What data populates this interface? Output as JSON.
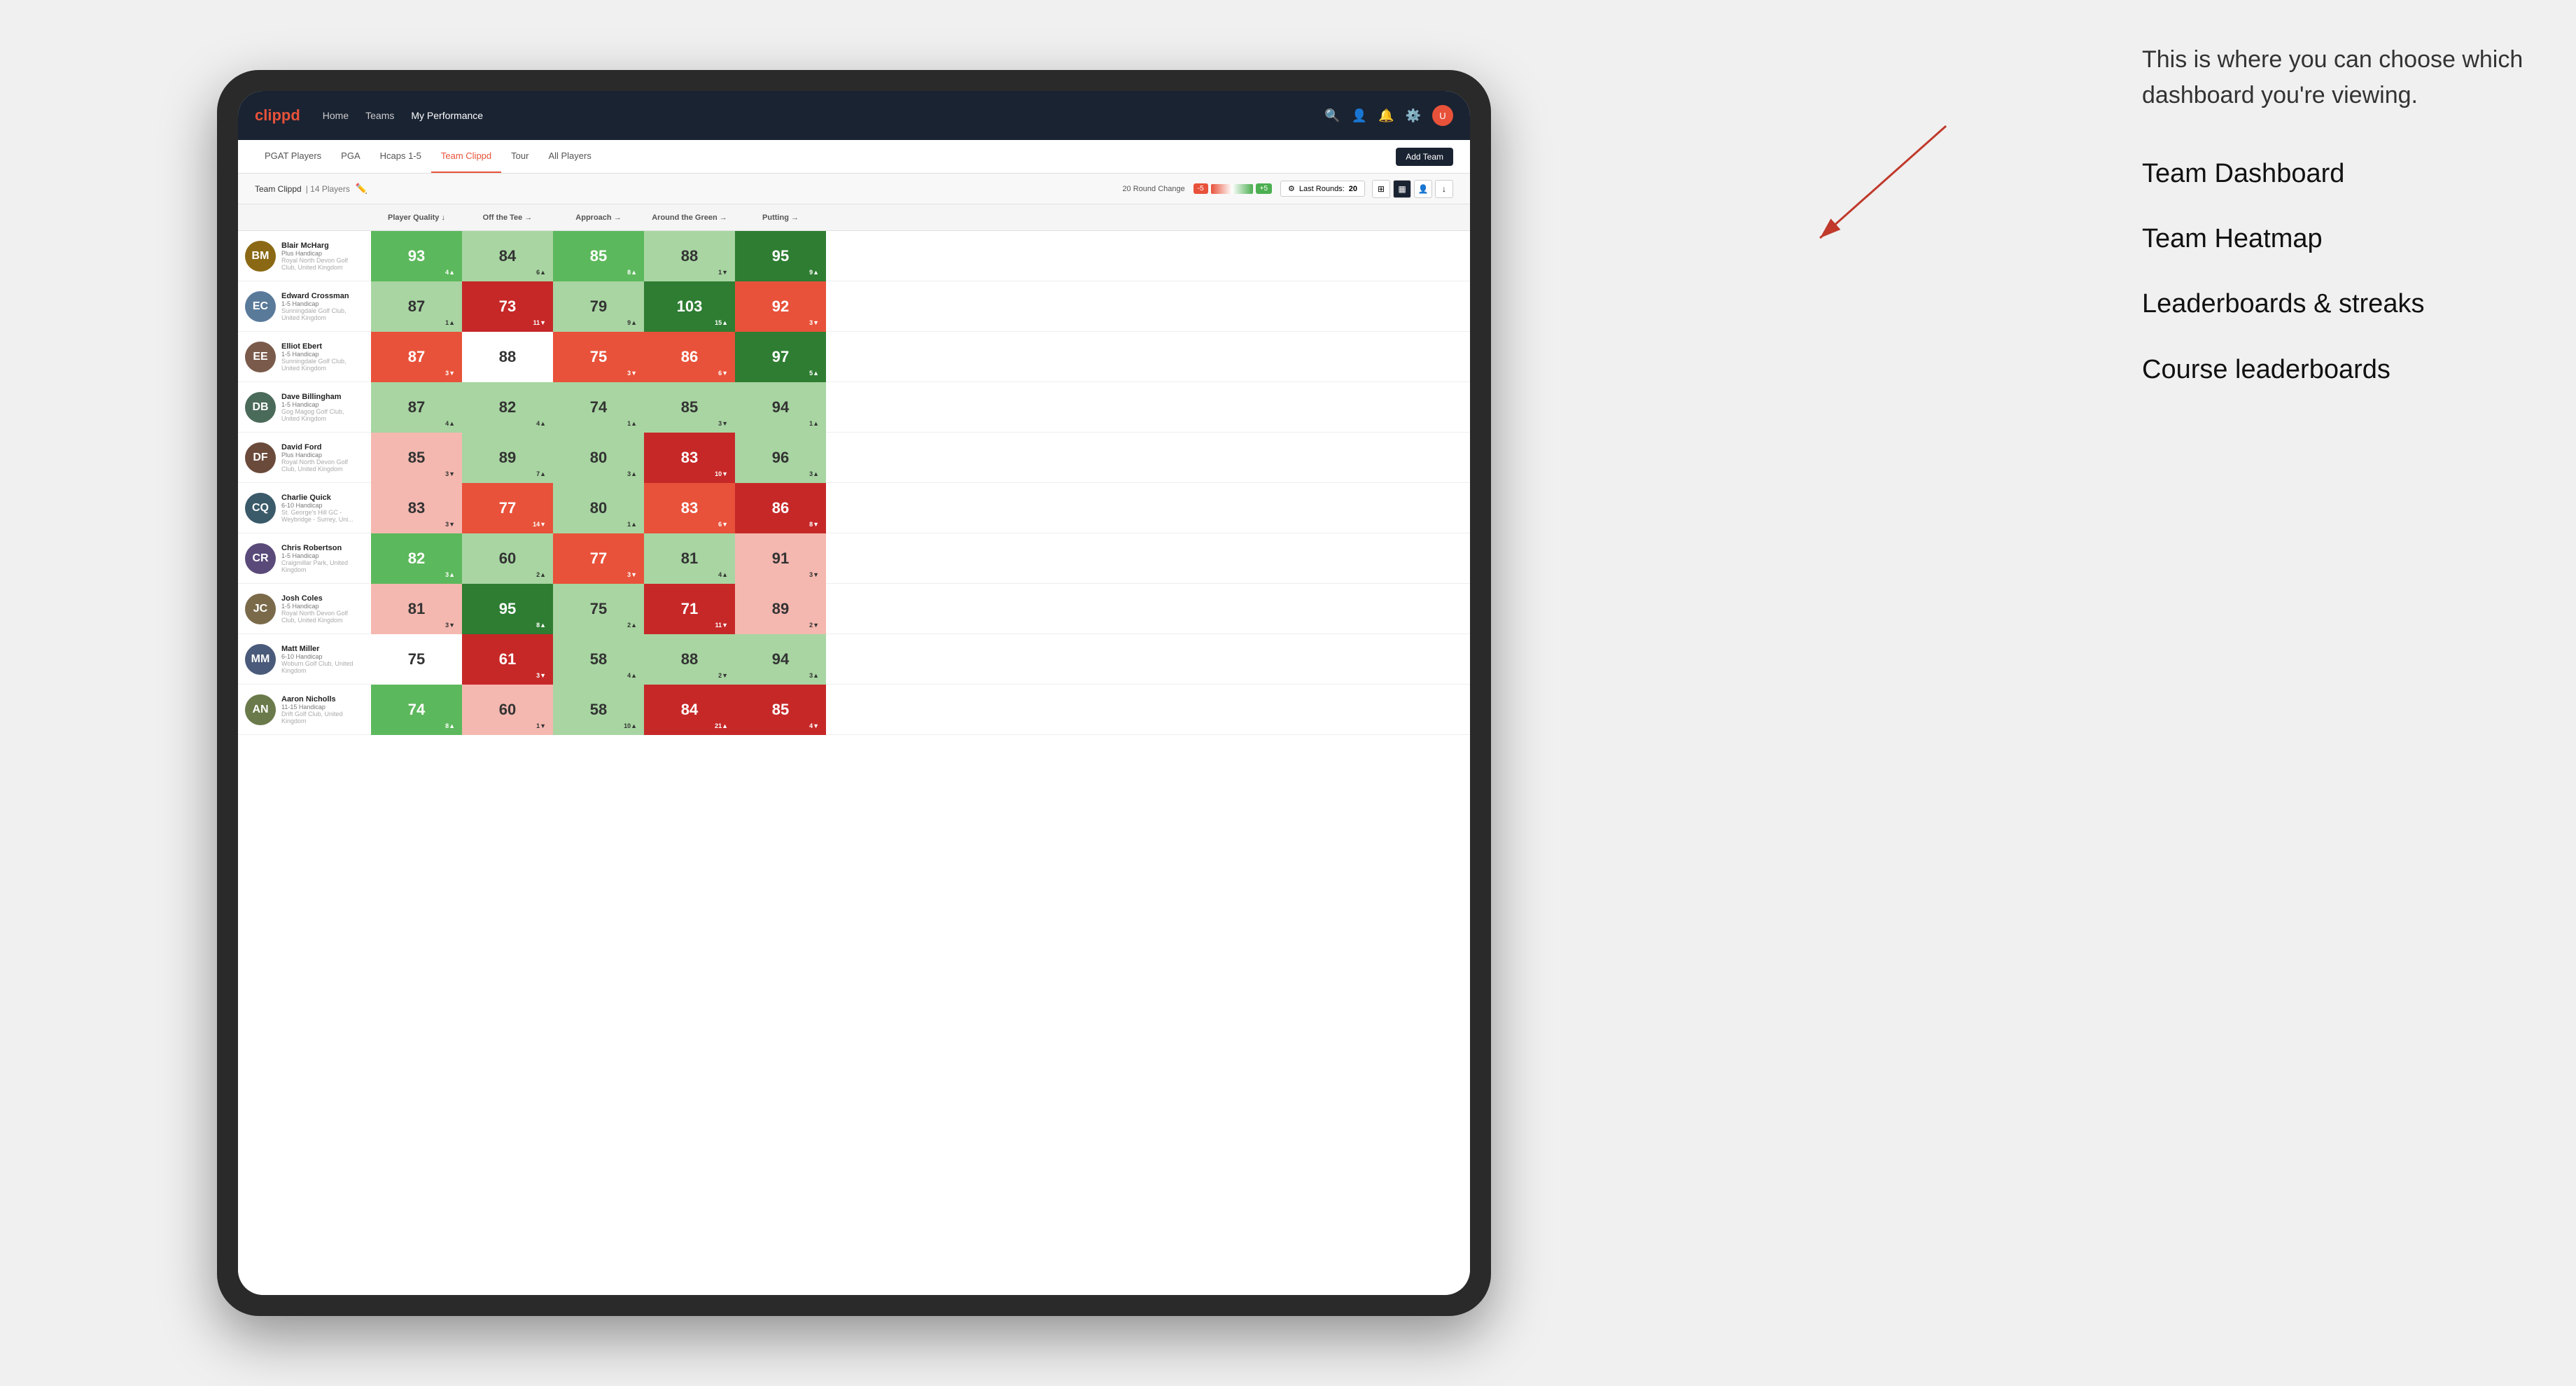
{
  "annotation": {
    "intro": "This is where you can choose which dashboard you're viewing.",
    "items": [
      "Team Dashboard",
      "Team Heatmap",
      "Leaderboards & streaks",
      "Course leaderboards"
    ]
  },
  "nav": {
    "logo": "clippd",
    "items": [
      "Home",
      "Teams",
      "My Performance"
    ],
    "icons": [
      "search",
      "user",
      "bell",
      "settings",
      "avatar"
    ]
  },
  "tabs": {
    "items": [
      "PGAT Players",
      "PGA",
      "Hcaps 1-5",
      "Team Clippd",
      "Tour",
      "All Players"
    ],
    "active": "Team Clippd",
    "add_button": "Add Team"
  },
  "sub_header": {
    "team_name": "Team Clippd",
    "player_count": "| 14 Players",
    "round_change_label": "20 Round Change",
    "badge_neg": "-5",
    "badge_pos": "+5",
    "last_rounds_label": "Last Rounds:",
    "last_rounds_value": "20"
  },
  "table": {
    "headers": [
      "Player Quality ↓",
      "Off the Tee →",
      "Approach →",
      "Around the Green →",
      "Putting →"
    ],
    "players": [
      {
        "name": "Blair McHarg",
        "handicap": "Plus Handicap",
        "club": "Royal North Devon Golf Club, United Kingdom",
        "initials": "BM",
        "color": "#8B6914",
        "scores": [
          {
            "value": "93",
            "change": "4",
            "dir": "up",
            "style": "mid-green"
          },
          {
            "value": "84",
            "change": "6",
            "dir": "up",
            "style": "light-green"
          },
          {
            "value": "85",
            "change": "8",
            "dir": "up",
            "style": "mid-green"
          },
          {
            "value": "88",
            "change": "1",
            "dir": "down",
            "style": "light-green"
          },
          {
            "value": "95",
            "change": "9",
            "dir": "up",
            "style": "dark-green"
          }
        ]
      },
      {
        "name": "Edward Crossman",
        "handicap": "1-5 Handicap",
        "club": "Sunningdale Golf Club, United Kingdom",
        "initials": "EC",
        "color": "#5a7a9a",
        "scores": [
          {
            "value": "87",
            "change": "1",
            "dir": "up",
            "style": "light-green"
          },
          {
            "value": "73",
            "change": "11",
            "dir": "down",
            "style": "dark-red"
          },
          {
            "value": "79",
            "change": "9",
            "dir": "up",
            "style": "light-green"
          },
          {
            "value": "103",
            "change": "15",
            "dir": "up",
            "style": "dark-green"
          },
          {
            "value": "92",
            "change": "3",
            "dir": "down",
            "style": "mid-red"
          }
        ]
      },
      {
        "name": "Elliot Ebert",
        "handicap": "1-5 Handicap",
        "club": "Sunningdale Golf Club, United Kingdom",
        "initials": "EE",
        "color": "#7a5a4a",
        "scores": [
          {
            "value": "87",
            "change": "3",
            "dir": "down",
            "style": "mid-red"
          },
          {
            "value": "88",
            "change": "",
            "dir": "",
            "style": "white"
          },
          {
            "value": "75",
            "change": "3",
            "dir": "down",
            "style": "mid-red"
          },
          {
            "value": "86",
            "change": "6",
            "dir": "down",
            "style": "mid-red"
          },
          {
            "value": "97",
            "change": "5",
            "dir": "up",
            "style": "dark-green"
          }
        ]
      },
      {
        "name": "Dave Billingham",
        "handicap": "1-5 Handicap",
        "club": "Gog Magog Golf Club, United Kingdom",
        "initials": "DB",
        "color": "#4a6a5a",
        "scores": [
          {
            "value": "87",
            "change": "4",
            "dir": "up",
            "style": "light-green"
          },
          {
            "value": "82",
            "change": "4",
            "dir": "up",
            "style": "light-green"
          },
          {
            "value": "74",
            "change": "1",
            "dir": "up",
            "style": "light-green"
          },
          {
            "value": "85",
            "change": "3",
            "dir": "down",
            "style": "light-green"
          },
          {
            "value": "94",
            "change": "1",
            "dir": "up",
            "style": "light-green"
          }
        ]
      },
      {
        "name": "David Ford",
        "handicap": "Plus Handicap",
        "club": "Royal North Devon Golf Club, United Kingdom",
        "initials": "DF",
        "color": "#6a4a3a",
        "scores": [
          {
            "value": "85",
            "change": "3",
            "dir": "down",
            "style": "light-red"
          },
          {
            "value": "89",
            "change": "7",
            "dir": "up",
            "style": "light-green"
          },
          {
            "value": "80",
            "change": "3",
            "dir": "up",
            "style": "light-green"
          },
          {
            "value": "83",
            "change": "10",
            "dir": "down",
            "style": "dark-red"
          },
          {
            "value": "96",
            "change": "3",
            "dir": "up",
            "style": "light-green"
          }
        ]
      },
      {
        "name": "Charlie Quick",
        "handicap": "6-10 Handicap",
        "club": "St. George's Hill GC - Weybridge - Surrey, Uni...",
        "initials": "CQ",
        "color": "#3a5a6a",
        "scores": [
          {
            "value": "83",
            "change": "3",
            "dir": "down",
            "style": "light-red"
          },
          {
            "value": "77",
            "change": "14",
            "dir": "down",
            "style": "mid-red"
          },
          {
            "value": "80",
            "change": "1",
            "dir": "up",
            "style": "light-green"
          },
          {
            "value": "83",
            "change": "6",
            "dir": "down",
            "style": "mid-red"
          },
          {
            "value": "86",
            "change": "8",
            "dir": "down",
            "style": "dark-red"
          }
        ]
      },
      {
        "name": "Chris Robertson",
        "handicap": "1-5 Handicap",
        "club": "Craigmillar Park, United Kingdom",
        "initials": "CR",
        "color": "#5a4a7a",
        "scores": [
          {
            "value": "82",
            "change": "3",
            "dir": "up",
            "style": "mid-green"
          },
          {
            "value": "60",
            "change": "2",
            "dir": "up",
            "style": "light-green"
          },
          {
            "value": "77",
            "change": "3",
            "dir": "down",
            "style": "mid-red"
          },
          {
            "value": "81",
            "change": "4",
            "dir": "up",
            "style": "light-green"
          },
          {
            "value": "91",
            "change": "3",
            "dir": "down",
            "style": "light-red"
          }
        ]
      },
      {
        "name": "Josh Coles",
        "handicap": "1-5 Handicap",
        "club": "Royal North Devon Golf Club, United Kingdom",
        "initials": "JC",
        "color": "#7a6a4a",
        "scores": [
          {
            "value": "81",
            "change": "3",
            "dir": "down",
            "style": "light-red"
          },
          {
            "value": "95",
            "change": "8",
            "dir": "up",
            "style": "dark-green"
          },
          {
            "value": "75",
            "change": "2",
            "dir": "up",
            "style": "light-green"
          },
          {
            "value": "71",
            "change": "11",
            "dir": "down",
            "style": "dark-red"
          },
          {
            "value": "89",
            "change": "2",
            "dir": "down",
            "style": "light-red"
          }
        ]
      },
      {
        "name": "Matt Miller",
        "handicap": "6-10 Handicap",
        "club": "Woburn Golf Club, United Kingdom",
        "initials": "MM",
        "color": "#4a5a7a",
        "scores": [
          {
            "value": "75",
            "change": "",
            "dir": "",
            "style": "white"
          },
          {
            "value": "61",
            "change": "3",
            "dir": "down",
            "style": "dark-red"
          },
          {
            "value": "58",
            "change": "4",
            "dir": "up",
            "style": "light-green"
          },
          {
            "value": "88",
            "change": "2",
            "dir": "down",
            "style": "light-green"
          },
          {
            "value": "94",
            "change": "3",
            "dir": "up",
            "style": "light-green"
          }
        ]
      },
      {
        "name": "Aaron Nicholls",
        "handicap": "11-15 Handicap",
        "club": "Drift Golf Club, United Kingdom",
        "initials": "AN",
        "color": "#6a7a4a",
        "scores": [
          {
            "value": "74",
            "change": "8",
            "dir": "up",
            "style": "mid-green"
          },
          {
            "value": "60",
            "change": "1",
            "dir": "down",
            "style": "light-red"
          },
          {
            "value": "58",
            "change": "10",
            "dir": "up",
            "style": "light-green"
          },
          {
            "value": "84",
            "change": "21",
            "dir": "up",
            "style": "dark-red"
          },
          {
            "value": "85",
            "change": "4",
            "dir": "down",
            "style": "dark-red"
          }
        ]
      }
    ]
  },
  "colors": {
    "dark-green": "#2e7d32",
    "mid-green": "#5cb85c",
    "light-green": "#a8d5a2",
    "white": "#ffffff",
    "light-red": "#f4a9a0",
    "mid-red": "#e8523a",
    "dark-red": "#c62828",
    "nav-bg": "#1a2332",
    "accent": "#e8523a"
  }
}
